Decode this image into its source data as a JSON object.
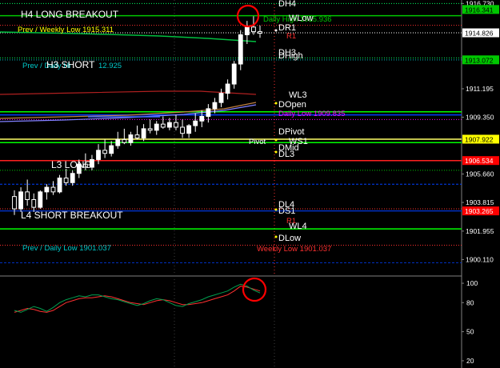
{
  "chart_data": [
    {
      "type": "candlestick",
      "ylim": [
        1899.3,
        1916.8
      ],
      "candles": [
        {
          "o": 1904.2,
          "h": 1904.6,
          "l": 1903.0,
          "c": 1903.4
        },
        {
          "o": 1903.4,
          "h": 1904.8,
          "l": 1903.2,
          "c": 1904.5
        },
        {
          "o": 1904.5,
          "h": 1905.3,
          "l": 1903.6,
          "c": 1904.0
        },
        {
          "o": 1904.0,
          "h": 1904.4,
          "l": 1903.2,
          "c": 1903.5
        },
        {
          "o": 1903.5,
          "h": 1904.6,
          "l": 1903.4,
          "c": 1904.5
        },
        {
          "o": 1904.5,
          "h": 1905.0,
          "l": 1904.0,
          "c": 1904.8
        },
        {
          "o": 1904.8,
          "h": 1905.2,
          "l": 1904.3,
          "c": 1904.5
        },
        {
          "o": 1904.5,
          "h": 1905.6,
          "l": 1904.4,
          "c": 1905.4
        },
        {
          "o": 1905.4,
          "h": 1906.0,
          "l": 1904.9,
          "c": 1905.1
        },
        {
          "o": 1905.1,
          "h": 1905.9,
          "l": 1904.9,
          "c": 1905.7
        },
        {
          "o": 1905.7,
          "h": 1906.6,
          "l": 1905.4,
          "c": 1906.3
        },
        {
          "o": 1906.3,
          "h": 1907.0,
          "l": 1905.9,
          "c": 1906.1
        },
        {
          "o": 1906.1,
          "h": 1906.9,
          "l": 1905.9,
          "c": 1906.6
        },
        {
          "o": 1906.6,
          "h": 1907.6,
          "l": 1906.3,
          "c": 1907.2
        },
        {
          "o": 1907.2,
          "h": 1907.9,
          "l": 1906.7,
          "c": 1907.0
        },
        {
          "o": 1907.0,
          "h": 1907.8,
          "l": 1906.8,
          "c": 1907.5
        },
        {
          "o": 1907.5,
          "h": 1908.4,
          "l": 1907.3,
          "c": 1907.9
        },
        {
          "o": 1907.9,
          "h": 1908.6,
          "l": 1907.6,
          "c": 1907.7
        },
        {
          "o": 1907.7,
          "h": 1908.4,
          "l": 1907.5,
          "c": 1908.2
        },
        {
          "o": 1908.2,
          "h": 1908.8,
          "l": 1907.9,
          "c": 1908.0
        },
        {
          "o": 1908.0,
          "h": 1908.9,
          "l": 1907.8,
          "c": 1908.6
        },
        {
          "o": 1908.6,
          "h": 1909.2,
          "l": 1908.3,
          "c": 1908.5
        },
        {
          "o": 1908.5,
          "h": 1909.1,
          "l": 1908.2,
          "c": 1908.9
        },
        {
          "o": 1908.9,
          "h": 1909.4,
          "l": 1908.6,
          "c": 1908.7
        },
        {
          "o": 1908.7,
          "h": 1909.3,
          "l": 1908.5,
          "c": 1909.0
        },
        {
          "o": 1909.0,
          "h": 1909.5,
          "l": 1908.5,
          "c": 1908.7
        },
        {
          "o": 1908.7,
          "h": 1909.2,
          "l": 1908.0,
          "c": 1908.3
        },
        {
          "o": 1908.3,
          "h": 1908.9,
          "l": 1908.0,
          "c": 1908.8
        },
        {
          "o": 1908.8,
          "h": 1909.6,
          "l": 1908.4,
          "c": 1909.1
        },
        {
          "o": 1909.1,
          "h": 1909.8,
          "l": 1908.7,
          "c": 1909.4
        },
        {
          "o": 1909.4,
          "h": 1910.2,
          "l": 1909.0,
          "c": 1909.9
        },
        {
          "o": 1909.9,
          "h": 1910.6,
          "l": 1909.6,
          "c": 1910.3
        },
        {
          "o": 1910.3,
          "h": 1911.2,
          "l": 1910.0,
          "c": 1910.9
        },
        {
          "o": 1910.9,
          "h": 1911.8,
          "l": 1910.5,
          "c": 1911.5
        },
        {
          "o": 1911.5,
          "h": 1913.0,
          "l": 1911.2,
          "c": 1912.8
        },
        {
          "o": 1912.8,
          "h": 1915.0,
          "l": 1912.4,
          "c": 1914.7
        },
        {
          "o": 1914.7,
          "h": 1915.6,
          "l": 1914.1,
          "c": 1915.2
        },
        {
          "o": 1915.2,
          "h": 1915.9,
          "l": 1914.7,
          "c": 1914.9
        },
        {
          "o": 1914.9,
          "h": 1915.3,
          "l": 1914.5,
          "c": 1914.8
        }
      ],
      "price_axis_ticks": [
        "1916.730",
        "1911.195",
        "1909.350",
        "1905.660",
        "1903.815",
        "1901.955",
        "1900.110"
      ],
      "price_tags": [
        {
          "text": "1916.341",
          "value": 1916.341,
          "bg": "#00c800",
          "fg": "#000000"
        },
        {
          "text": "1914.826",
          "value": 1914.826,
          "bg": "#ffffff",
          "fg": "#000000"
        },
        {
          "text": "1913.072",
          "value": 1913.072,
          "bg": "#00c800",
          "fg": "#000000"
        },
        {
          "text": "1907.922",
          "value": 1907.922,
          "bg": "#ffff00",
          "fg": "#000000"
        },
        {
          "text": "1906.534",
          "value": 1906.534,
          "bg": "#ff0000",
          "fg": "#ffffff"
        },
        {
          "text": "1903.265",
          "value": 1903.265,
          "bg": "#ff0000",
          "fg": "#ffffff"
        }
      ],
      "horizontal_lines": [
        {
          "name": "DH4",
          "value": 1916.73,
          "color": "#00ff66",
          "style": "dotted"
        },
        {
          "name": "Daily High",
          "value": 1915.936,
          "color": "#00c800",
          "style": "solid"
        },
        {
          "name": "Weekly Low 1915",
          "value": 1915.311,
          "color": "#ff3030",
          "style": "dotted"
        },
        {
          "name": "DR1",
          "value": 1914.826,
          "color": "#ffffff",
          "style": "dotted"
        },
        {
          "name": "H3 SHORT",
          "value": 1913.07,
          "color": "#00c8c8",
          "style": "dotted"
        },
        {
          "name": "DH3",
          "value": 1913.2,
          "color": "#00ff66",
          "style": "dotted"
        },
        {
          "name": "WL3",
          "value": 1909.7,
          "color": "#00ff00",
          "style": "solid"
        },
        {
          "name": "Blue mid",
          "value": 1909.5,
          "color": "#0040ff",
          "style": "solid"
        },
        {
          "name": "DOpen",
          "value": 1909.2,
          "color": "#ff00ff",
          "style": "dotted"
        },
        {
          "name": "Pivot",
          "value": 1907.922,
          "color": "#ffff66",
          "style": "solid"
        },
        {
          "name": "WS1",
          "value": 1907.7,
          "color": "#00ff00",
          "style": "solid"
        },
        {
          "name": "DL3",
          "value": 1906.534,
          "color": "#ff2020",
          "style": "solid"
        },
        {
          "name": "L3 LONG",
          "value": 1905.9,
          "color": "#00c800",
          "style": "dotted"
        },
        {
          "name": "Blue L3",
          "value": 1905.0,
          "color": "#0040ff",
          "style": "dashed"
        },
        {
          "name": "DL4",
          "value": 1903.4,
          "color": "#ff3030",
          "style": "dotted"
        },
        {
          "name": "DS1",
          "value": 1903.265,
          "color": "#0030c0",
          "style": "solid"
        },
        {
          "name": "WL4",
          "value": 1902.1,
          "color": "#00ff00",
          "style": "solid"
        },
        {
          "name": "DLow",
          "value": 1901.037,
          "color": "#ff3030",
          "style": "dotted"
        },
        {
          "name": "L4 Blue",
          "value": 1899.9,
          "color": "#0030c0",
          "style": "dashed"
        }
      ]
    },
    {
      "type": "line",
      "ylim": [
        15,
        105
      ],
      "y_ticks": [
        100,
        80,
        50,
        20
      ],
      "series": [
        {
          "color": "#ff3030",
          "values": [
            70,
            72,
            74,
            73,
            71,
            70,
            72,
            76,
            80,
            82,
            84,
            85,
            85,
            86,
            87,
            86,
            84,
            82,
            80,
            79,
            78,
            80,
            82,
            83,
            82,
            80,
            78,
            78,
            79,
            80,
            82,
            84,
            86,
            88,
            92,
            97,
            96,
            94,
            92
          ]
        },
        {
          "color": "#00a050",
          "values": [
            72,
            70,
            73,
            76,
            74,
            71,
            75,
            80,
            83,
            85,
            87,
            86,
            88,
            88,
            86,
            84,
            83,
            81,
            79,
            77,
            79,
            82,
            84,
            83,
            80,
            77,
            76,
            79,
            81,
            83,
            86,
            88,
            90,
            92,
            96,
            99,
            97,
            93,
            90
          ]
        }
      ]
    }
  ],
  "labels": {
    "h4_breakout": "H4 LONG BREAKOUT",
    "prev_weekly_low": "Prev / Weekly Low 1915.311",
    "h3_short_left": "Prev / Daily Hi",
    "h3_short": "H3 SHORT",
    "h3_short_val": "12.925",
    "l3_long": "L3 LONG",
    "l4_short_breakout": "L4 SHORT BREAKOUT",
    "prev_daily_low": "Prev / Daily Low 1901.037",
    "dh4": "DH4",
    "daily_high": "Daily High 1915.936",
    "wlow": "WLow",
    "dr1": "DR1",
    "r1_top": "R1",
    "dh3": "DH3",
    "dhigh": "DHigh",
    "wl3": "WL3",
    "dopen": "DOpen",
    "daily_low": "Daily Low 1909.835",
    "dpivot": "DPivot",
    "pivot": "Pivot",
    "ws1": "WS1",
    "dmid": "DMid",
    "dl3": "DL3",
    "dl4": "DL4",
    "ds1": "DS1",
    "r1_bottom": "R1",
    "wl4": "WL4",
    "dlow": "DLow",
    "weekly_low": "Weekly Low 1901.037"
  },
  "colors": {
    "background": "#000000",
    "annotation": "#ff0000",
    "axis_text": "#ffffff"
  }
}
